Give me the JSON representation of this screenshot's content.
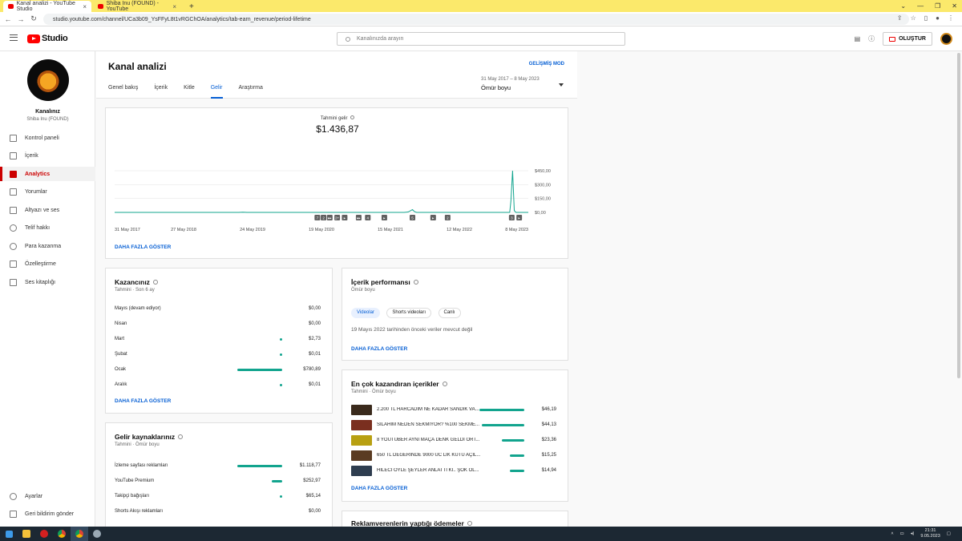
{
  "browser": {
    "tabs": [
      {
        "title": "Kanal analizi - YouTube Studio"
      },
      {
        "title": "Shiba Inu (FOUND) - YouTube"
      }
    ],
    "new_tab": "+",
    "url": "studio.youtube.com/channel/UCa3b09_YsFFyL8t1vRGChOA/analytics/tab-earn_revenue/period-lifetime"
  },
  "header": {
    "logo_text": "Studio",
    "search_placeholder": "Kanalınızda arayın",
    "create_label": "OLUŞTUR"
  },
  "sidebar": {
    "channel_name": "Kanalınız",
    "channel_handle": "Shiba Inu (FOUND)",
    "items": [
      {
        "label": "Kontrol paneli"
      },
      {
        "label": "İçerik"
      },
      {
        "label": "Analytics"
      },
      {
        "label": "Yorumlar"
      },
      {
        "label": "Altyazı ve ses"
      },
      {
        "label": "Telif hakkı"
      },
      {
        "label": "Para kazanma"
      },
      {
        "label": "Özelleştirme"
      },
      {
        "label": "Ses kitaplığı"
      }
    ],
    "bottom": [
      {
        "label": "Ayarlar"
      },
      {
        "label": "Geri bildirim gönder"
      }
    ]
  },
  "page": {
    "title": "Kanal analizi",
    "advanced_mode": "GELİŞMİŞ MOD",
    "tabs": [
      {
        "label": "Genel bakış"
      },
      {
        "label": "İçerik"
      },
      {
        "label": "Kitle"
      },
      {
        "label": "Gelir"
      },
      {
        "label": "Araştırma"
      }
    ],
    "period_range": "31 May 2017 – 8 May 2023",
    "period_value": "Ömür boyu"
  },
  "revenue_card": {
    "metric_label": "Tahmini gelir",
    "metric_value": "$1.436,87",
    "show_more": "DAHA FAZLA GÖSTER"
  },
  "chart_data": {
    "type": "line",
    "x_tick_labels": [
      "31 May 2017",
      "27 May 2018",
      "24 May 2019",
      "19 May 2020",
      "15 May 2021",
      "12 May 2022",
      "8 May 2023"
    ],
    "y_tick_labels": [
      "$450,00",
      "$300,00",
      "$150,00",
      "$0,00"
    ],
    "ylim": [
      0,
      450
    ],
    "series_points": [
      {
        "t": 0.0,
        "v": 0
      },
      {
        "t": 0.3,
        "v": 0
      },
      {
        "t": 0.31,
        "v": 3
      },
      {
        "t": 0.32,
        "v": 0
      },
      {
        "t": 0.7,
        "v": 0
      },
      {
        "t": 0.71,
        "v": 5
      },
      {
        "t": 0.72,
        "v": 30
      },
      {
        "t": 0.725,
        "v": 8
      },
      {
        "t": 0.73,
        "v": 0
      },
      {
        "t": 0.955,
        "v": 0
      },
      {
        "t": 0.958,
        "v": 120
      },
      {
        "t": 0.962,
        "v": 450
      },
      {
        "t": 0.966,
        "v": 20
      },
      {
        "t": 0.97,
        "v": 0
      },
      {
        "t": 1.0,
        "v": 0
      }
    ],
    "grid": true,
    "color": "#12a48e",
    "markers": [
      "7",
      "2",
      "▸▸",
      "2+",
      "▸",
      "▸▸",
      "4",
      "▸",
      "5",
      "▸",
      "2",
      "3",
      "▸"
    ]
  },
  "earnings_card": {
    "title": "Kazancınız",
    "subtitle": "Tahmini · Son 6 ay",
    "rows": [
      {
        "label": "Mayıs (devam ediyor)",
        "amount": "$0,00",
        "share": 0
      },
      {
        "label": "Nisan",
        "amount": "$0,00",
        "share": 0
      },
      {
        "label": "Mart",
        "amount": "$2,73",
        "share": 0.004
      },
      {
        "label": "Şubat",
        "amount": "$0,01",
        "share": 0.001
      },
      {
        "label": "Ocak",
        "amount": "$780,89",
        "share": 1
      },
      {
        "label": "Aralık",
        "amount": "$0,01",
        "share": 0.001
      }
    ],
    "show_more": "DAHA FAZLA GÖSTER"
  },
  "sources_card": {
    "title": "Gelir kaynaklarınız",
    "subtitle": "Tahmini · Ömür boyu",
    "rows": [
      {
        "label": "İzleme sayfası reklamları",
        "amount": "$1.118,77",
        "share": 1
      },
      {
        "label": "YouTube Premium",
        "amount": "$252,97",
        "share": 0.23
      },
      {
        "label": "Takipçi bağışları",
        "amount": "$65,14",
        "share": 0.06
      },
      {
        "label": "Shorts Akışı reklamları",
        "amount": "$0,00",
        "share": 0
      }
    ]
  },
  "content_perf_card": {
    "title": "İçerik performansı",
    "subtitle": "Ömür boyu",
    "chips": [
      {
        "label": "Videolar"
      },
      {
        "label": "Shorts videoları"
      },
      {
        "label": "Canlı"
      }
    ],
    "message": "19 Mayıs 2022 tarihinden önceki veriler mevcut değil",
    "show_more": "DAHA FAZLA GÖSTER"
  },
  "top_content_card": {
    "title": "En çok kazandıran içerikler",
    "subtitle": "Tahmini · Ömür boyu",
    "videos": [
      {
        "title": "2.200 TL HARCADIM NE KADAR SANDIK VA...",
        "amount": "$46,19",
        "share": 1,
        "thumb": "#3a2a1c"
      },
      {
        "title": "SİLAHIM NEDEN SEKMİYOR? %100 SEKME...",
        "amount": "$44,13",
        "share": 0.95,
        "thumb": "#7a2f1f"
      },
      {
        "title": "8 YOUTUBER AYNI MAÇA DENK GELDİ ORT...",
        "amount": "$23,36",
        "share": 0.5,
        "thumb": "#b8a012"
      },
      {
        "title": "650 TL DEĞERİNDE 9000 UC LİK KUTU AÇIL...",
        "amount": "$15,25",
        "share": 0.33,
        "thumb": "#5a3b22"
      },
      {
        "title": "HİLECİ ÖYLE ŞEYLER ANLATTI Kİ.. ŞOK OL...",
        "amount": "$14,94",
        "share": 0.32,
        "thumb": "#2e3d4f"
      }
    ],
    "show_more": "DAHA FAZLA GÖSTER"
  },
  "advertiser_card": {
    "title": "Reklamverenlerin yaptığı ödemeler"
  },
  "taskbar": {
    "time": "21:31",
    "date": "9.05.2023"
  }
}
